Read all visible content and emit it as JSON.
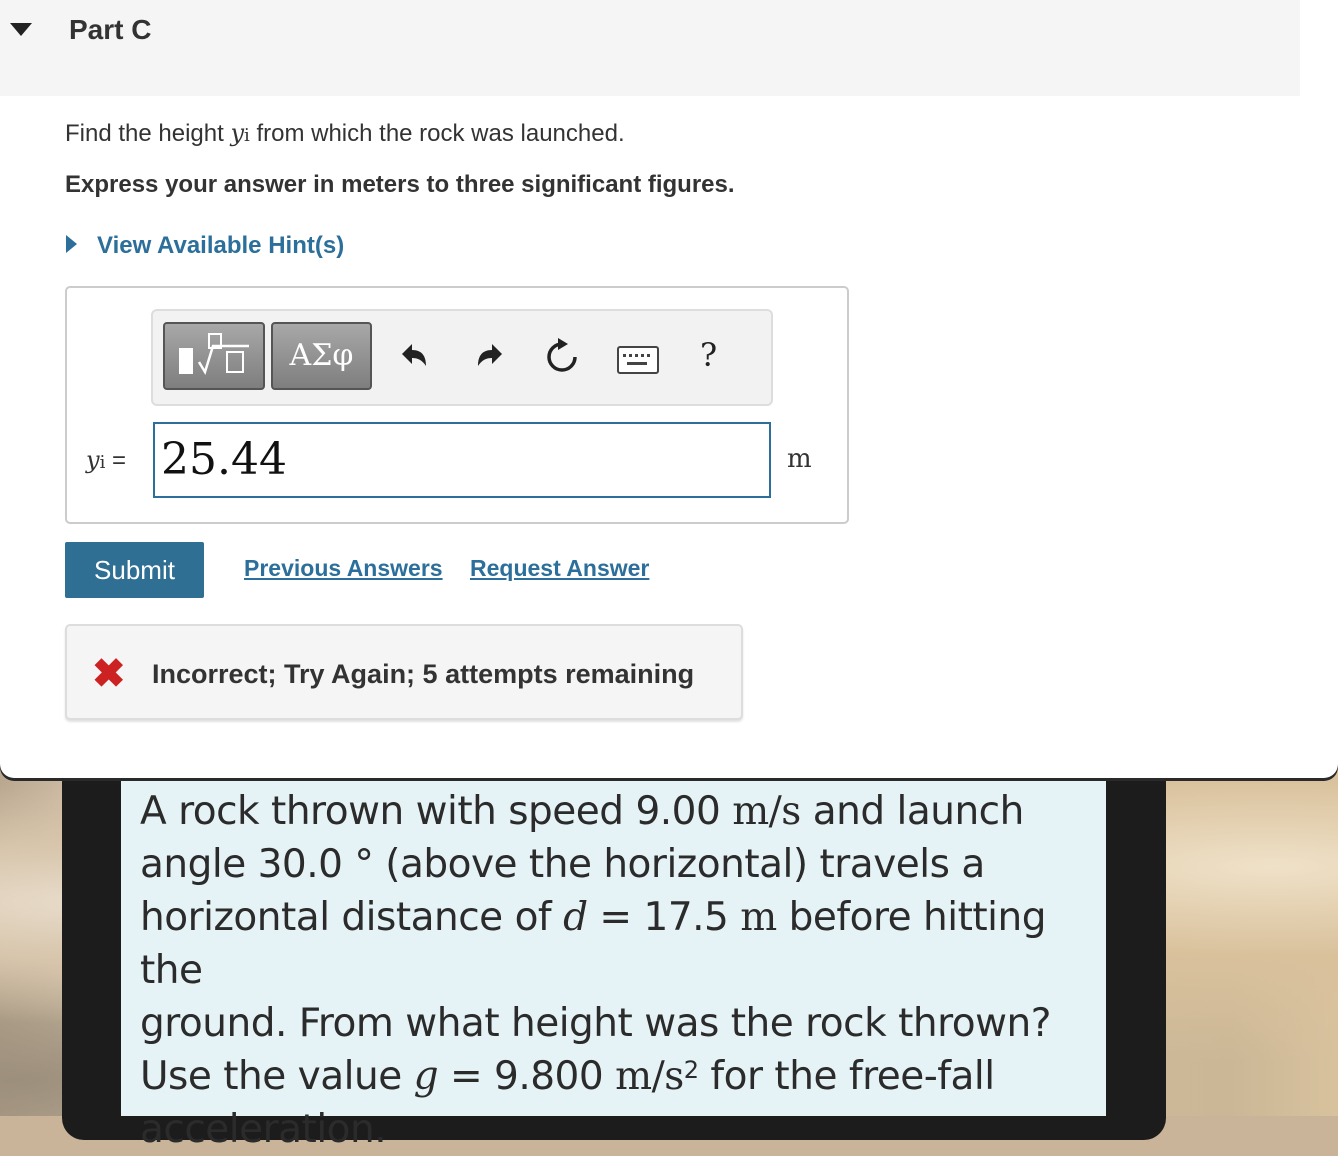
{
  "part": {
    "title": "Part C"
  },
  "question": {
    "text_before": "Find the height ",
    "variable": "y",
    "variable_sub": "i",
    "text_after": " from which the rock was launched.",
    "instruction": "Express your answer in meters to three significant figures."
  },
  "hints": {
    "label": "View Available Hint(s)"
  },
  "toolbar": {
    "template_label": "▮√▢",
    "greek_label": "ΑΣφ",
    "undo_icon": "↶",
    "redo_icon": "↷",
    "reset_icon": "↻",
    "help_label": "?"
  },
  "answer": {
    "var_name": "y",
    "var_sub": "i",
    "equals": " =",
    "value": "25.44",
    "unit": "m"
  },
  "actions": {
    "submit_label": "Submit",
    "previous_label": "Previous Answers",
    "request_label": "Request Answer"
  },
  "feedback": {
    "icon": "✖",
    "text": "Incorrect; Try Again; 5 attempts remaining"
  },
  "problem": {
    "line1_a": "A rock thrown with speed 9.00 ",
    "line1_unit": "m/s",
    "line1_b": " and launch",
    "line2": "angle 30.0 ° (above the horizontal) travels a",
    "line3_a": "horizontal distance of ",
    "line3_var": "d",
    "line3_b": " = 17.5 ",
    "line3_unit": "m",
    "line3_c": " before hitting the",
    "line4": "ground. From what height was the rock thrown?",
    "line5_a": "Use the value ",
    "line5_var": "g",
    "line5_b": " = 9.800 ",
    "line5_unit": "m/s",
    "line5_sup": "2",
    "line5_c": " for the free-fall",
    "line6": "acceleration."
  }
}
